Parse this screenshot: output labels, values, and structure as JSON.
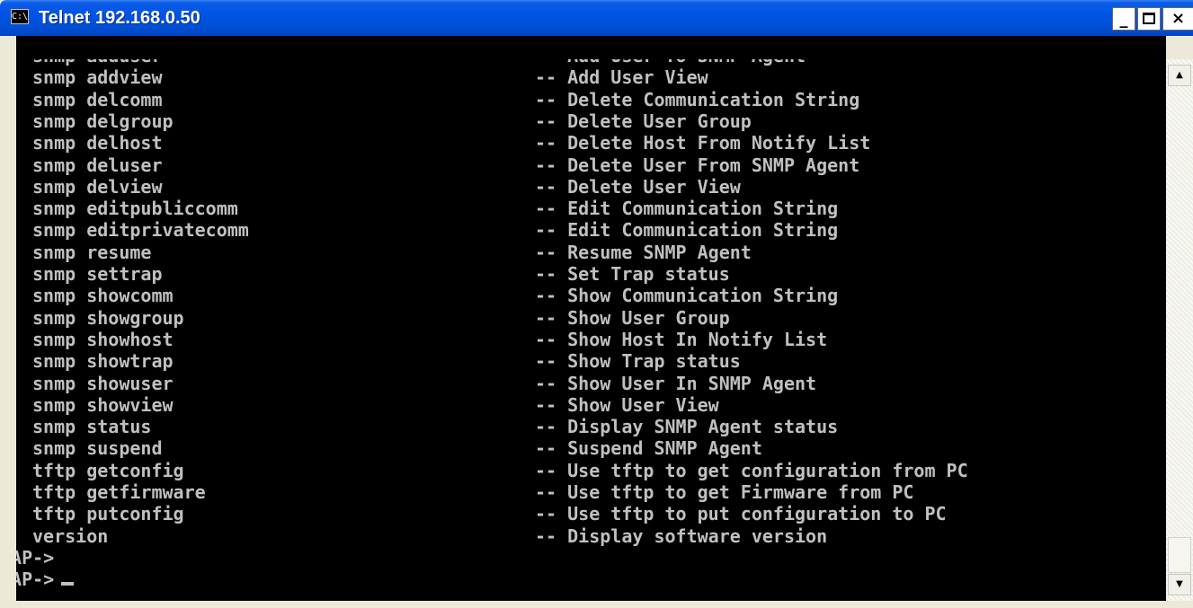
{
  "window": {
    "title": "Telnet 192.168.0.50",
    "icon_label": "C:\\",
    "minimize_label": "_",
    "close_label": "×"
  },
  "terminal": {
    "help_rows": [
      {
        "command": "snmp adduser",
        "description": "-- Add User To SNMP Agent"
      },
      {
        "command": "snmp addview",
        "description": "-- Add User View"
      },
      {
        "command": "snmp delcomm",
        "description": "-- Delete Communication String"
      },
      {
        "command": "snmp delgroup",
        "description": "-- Delete User Group"
      },
      {
        "command": "snmp delhost",
        "description": "-- Delete Host From Notify List"
      },
      {
        "command": "snmp deluser",
        "description": "-- Delete User From SNMP Agent"
      },
      {
        "command": "snmp delview",
        "description": "-- Delete User View"
      },
      {
        "command": "snmp editpubliccomm",
        "description": "-- Edit Communication String"
      },
      {
        "command": "snmp editprivatecomm",
        "description": "-- Edit Communication String"
      },
      {
        "command": "snmp resume",
        "description": "-- Resume SNMP Agent"
      },
      {
        "command": "snmp settrap",
        "description": "-- Set Trap status"
      },
      {
        "command": "snmp showcomm",
        "description": "-- Show Communication String"
      },
      {
        "command": "snmp showgroup",
        "description": "-- Show User Group"
      },
      {
        "command": "snmp showhost",
        "description": "-- Show Host In Notify List"
      },
      {
        "command": "snmp showtrap",
        "description": "-- Show Trap status"
      },
      {
        "command": "snmp showuser",
        "description": "-- Show User In SNMP Agent"
      },
      {
        "command": "snmp showview",
        "description": "-- Show User View"
      },
      {
        "command": "snmp status",
        "description": "-- Display SNMP Agent status"
      },
      {
        "command": "snmp suspend",
        "description": "-- Suspend SNMP Agent"
      },
      {
        "command": "tftp getconfig",
        "description": "-- Use tftp to get configuration from PC"
      },
      {
        "command": "tftp getfirmware",
        "description": "-- Use tftp to get Firmware from PC"
      },
      {
        "command": "tftp putconfig",
        "description": "-- Use tftp to put configuration to PC"
      },
      {
        "command": "version",
        "description": "-- Display software version"
      }
    ],
    "prompts": [
      "WAP->",
      "WAP->"
    ]
  },
  "scrollbar": {
    "up_arrow": "▲",
    "down_arrow": "▼"
  },
  "colors": {
    "titlebar": "#0054e3",
    "terminal_bg": "#000000",
    "terminal_fg": "#c0c0c0"
  }
}
